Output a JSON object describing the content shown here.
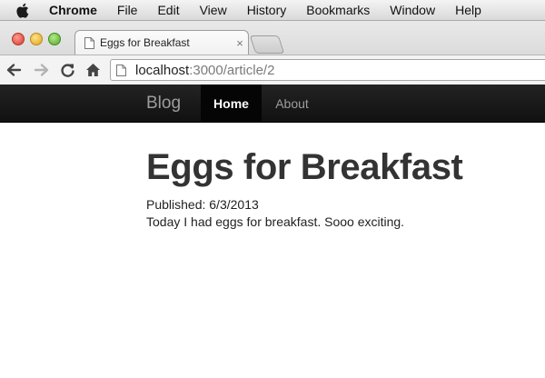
{
  "menubar": {
    "items": [
      "Chrome",
      "File",
      "Edit",
      "View",
      "History",
      "Bookmarks",
      "Window",
      "Help"
    ]
  },
  "browser": {
    "tab_title": "Eggs for Breakfast",
    "tab_close": "×",
    "url_host": "localhost",
    "url_path": ":3000/article/2"
  },
  "navbar": {
    "brand": "Blog",
    "links": [
      "Home",
      "About"
    ],
    "active": "Home"
  },
  "article": {
    "title": "Eggs for Breakfast",
    "published": "Published: 6/3/2013",
    "body": "Today I had eggs for breakfast. Sooo exciting."
  },
  "colors": {
    "navbar_bg": "#1b1b1b",
    "navbar_active_bg": "#050505",
    "navbar_text": "#9d9d9d",
    "title_text": "#333333"
  }
}
